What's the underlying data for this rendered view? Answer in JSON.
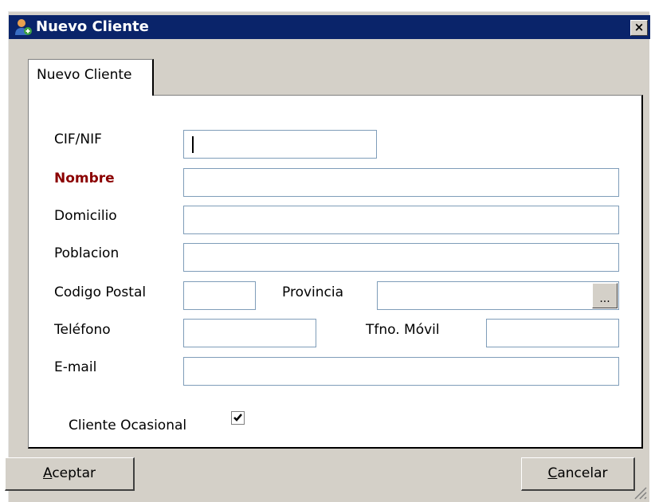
{
  "window": {
    "title": "Nuevo Cliente",
    "close_label": "×"
  },
  "tab": {
    "label": "Nuevo Cliente"
  },
  "form": {
    "cif_label": "CIF/NIF",
    "nombre_label": "Nombre",
    "domicilio_label": "Domicilio",
    "poblacion_label": "Poblacion",
    "codigo_postal_label": "Codigo Postal",
    "provincia_label": "Provincia",
    "provincia_button": "...",
    "telefono_label": "Teléfono",
    "movil_label": "Tfno. Móvil",
    "email_label": "E-mail",
    "ocasional_label": "Cliente Ocasional",
    "ocasional_checked": true
  },
  "buttons": {
    "aceptar_accel": "A",
    "aceptar_rest": "ceptar",
    "cancelar_accel": "C",
    "cancelar_rest": "ancelar"
  },
  "colors": {
    "title_bar": "#0a246a",
    "required_label": "#8b0000",
    "field_border": "#7f9db9"
  }
}
